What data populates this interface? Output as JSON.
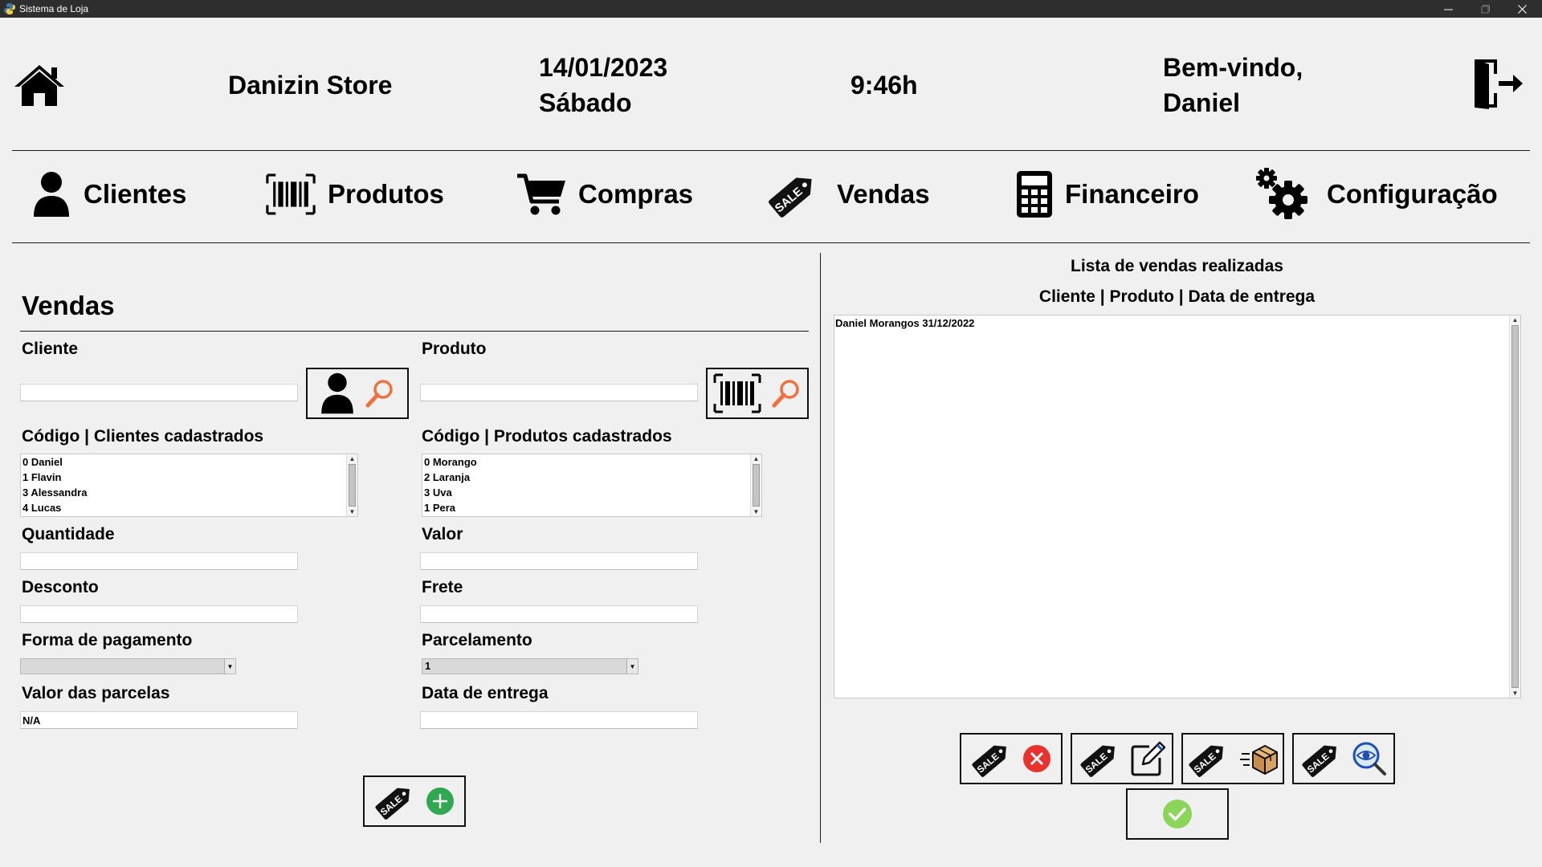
{
  "window": {
    "title": "Sistema de Loja"
  },
  "header": {
    "store_name": "Danizin Store",
    "date": "14/01/2023",
    "weekday": "Sábado",
    "time": "9:46h",
    "welcome_line1": "Bem-vindo,",
    "welcome_line2": "Daniel"
  },
  "nav": {
    "clientes": "Clientes",
    "produtos": "Produtos",
    "compras": "Compras",
    "vendas": "Vendas",
    "financeiro": "Financeiro",
    "configuracao": "Configuração"
  },
  "form": {
    "section_title": "Vendas",
    "cliente_label": "Cliente",
    "cliente_value": "",
    "produto_label": "Produto",
    "produto_value": "",
    "clientes_list_header": "Código | Clientes cadastrados",
    "clientes_list": [
      "0 Daniel",
      "1 Flavin",
      "3 Alessandra",
      "4 Lucas"
    ],
    "produtos_list_header": "Código | Produtos cadastrados",
    "produtos_list": [
      "0 Morango",
      "2 Laranja",
      "3 Uva",
      "1 Pera"
    ],
    "quantidade_label": "Quantidade",
    "quantidade_value": "",
    "valor_label": "Valor",
    "valor_value": "",
    "desconto_label": "Desconto",
    "desconto_value": "",
    "frete_label": "Frete",
    "frete_value": "",
    "pagamento_label": "Forma de pagamento",
    "pagamento_value": "",
    "parcelamento_label": "Parcelamento",
    "parcelamento_value": "1",
    "valor_parcelas_label": "Valor das parcelas",
    "valor_parcelas_value": "N/A",
    "data_entrega_label": "Data de entrega",
    "data_entrega_value": ""
  },
  "sales": {
    "title": "Lista de vendas realizadas",
    "columns": "Cliente | Produto | Data de entrega",
    "rows": [
      "Daniel Morangos 31/12/2022"
    ]
  },
  "icons": {
    "home": "home-icon",
    "logout": "logout-icon",
    "sale_tag": "sale-tag-icon",
    "search": "search-icon",
    "delete": "delete-icon",
    "edit": "edit-icon",
    "deliver": "package-icon",
    "view": "view-icon",
    "confirm": "check-icon",
    "add": "add-icon"
  },
  "colors": {
    "background": "#f0f0f0",
    "titlebar": "#2e2e2e",
    "search_orange": "#f07040",
    "add_green": "#2fa84f",
    "delete_red": "#e8322e",
    "confirm_green": "#8bd65a",
    "view_blue": "#1e50b4"
  }
}
